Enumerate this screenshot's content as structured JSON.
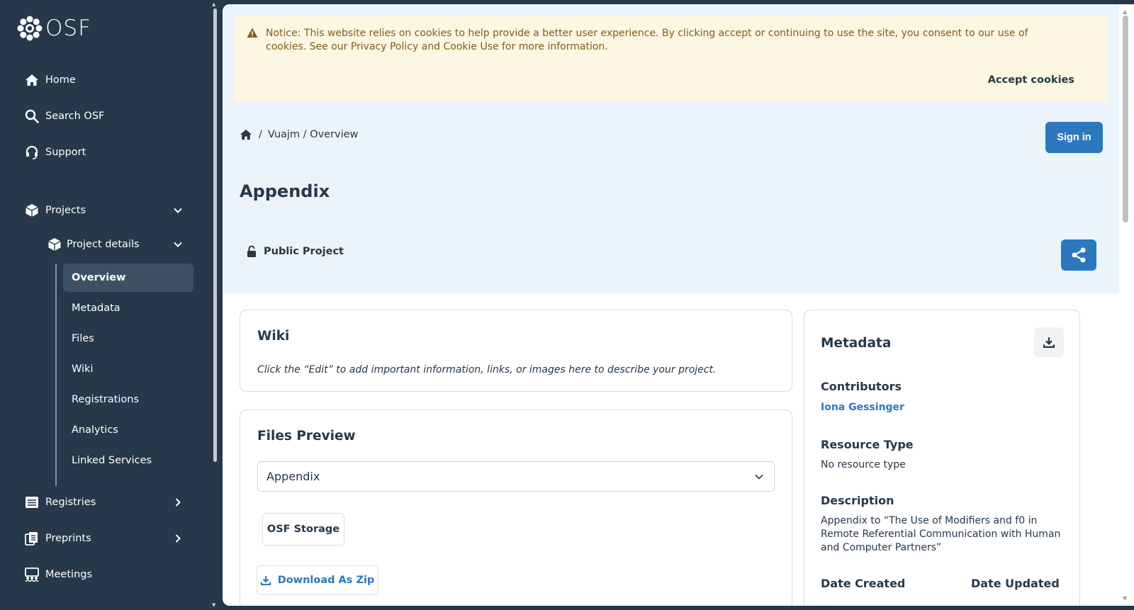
{
  "sidebar": {
    "logo_text": "OSF",
    "home": "Home",
    "search": "Search OSF",
    "support": "Support",
    "projects": "Projects",
    "project_details": "Project details",
    "items": [
      "Overview",
      "Metadata",
      "Files",
      "Wiki",
      "Registrations",
      "Analytics",
      "Linked Services"
    ],
    "registries": "Registries",
    "preprints": "Preprints",
    "meetings": "Meetings"
  },
  "cookie": {
    "message": "Notice: This website relies on cookies to help provide a better user experience. By clicking accept or continuing to use the site, you consent to our use of cookies. See our Privacy Policy and Cookie Use for more information.",
    "accept": "Accept cookies"
  },
  "breadcrumb": {
    "separator": "/",
    "path": "Vuajm / Overview"
  },
  "sign_in": "Sign in",
  "project": {
    "title": "Appendix",
    "visibility": "Public Project"
  },
  "wiki": {
    "title": "Wiki",
    "text": "Click the “Edit” to add important information, links, or images here to describe your project."
  },
  "files_preview": {
    "title": "Files Preview",
    "selected": "Appendix",
    "storage": "OSF Storage",
    "download_zip": "Download As Zip"
  },
  "metadata": {
    "title": "Metadata",
    "contributors_label": "Contributors",
    "contributor": "Iona Gessinger",
    "resource_type_label": "Resource Type",
    "resource_type": "No resource type",
    "description_label": "Description",
    "description": "Appendix to “The Use of Modifiers and f0 in Remote Referential Communication with Human and Computer Partners”",
    "date_created_label": "Date Created",
    "date_updated_label": "Date Updated"
  },
  "colors": {
    "sidebar": "#263849",
    "accent": "#2b78bf",
    "hero": "#ecf4fb",
    "notice": "#fdf6e3"
  }
}
